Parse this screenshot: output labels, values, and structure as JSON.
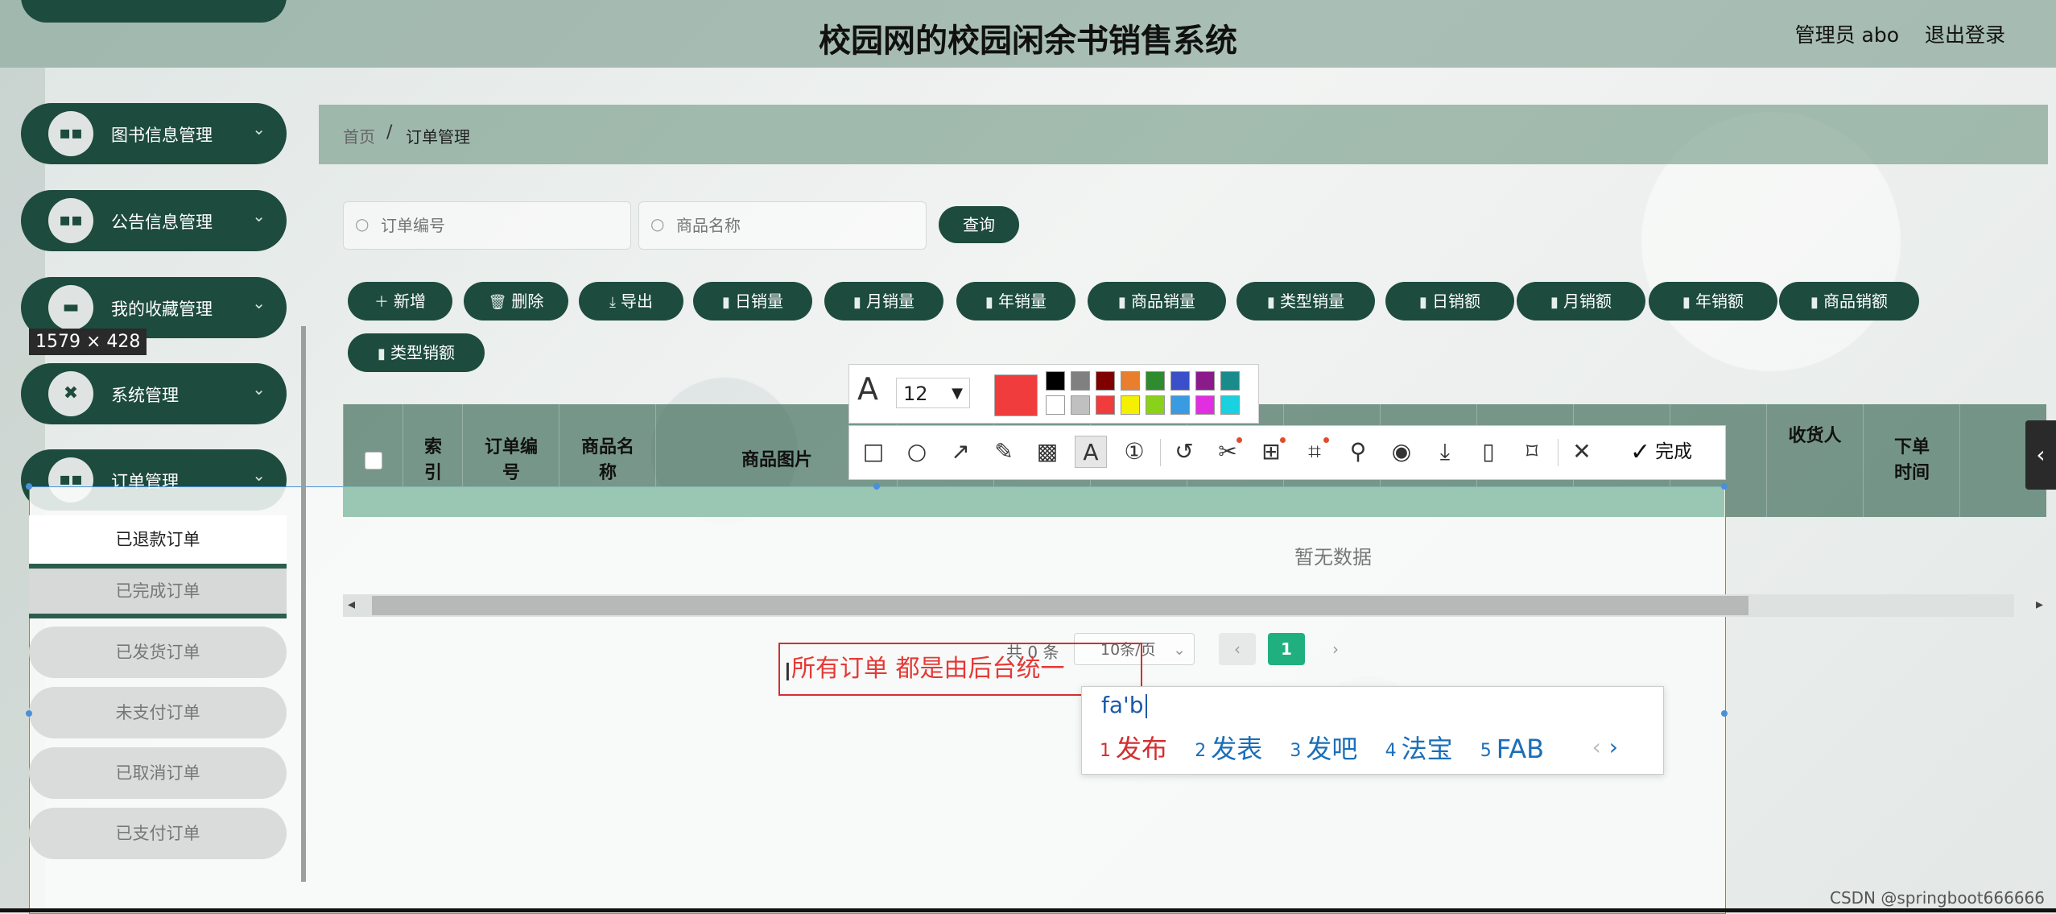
{
  "header": {
    "title": "校园网的校园闲余书销售系统",
    "admin": "管理员 abo",
    "logout": "退出登录"
  },
  "sidebar": {
    "menu": [
      {
        "label": "图书信息管理",
        "icon": "grid-icon"
      },
      {
        "label": "公告信息管理",
        "icon": "grid-icon"
      },
      {
        "label": "我的收藏管理",
        "icon": "monitor-icon"
      },
      {
        "label": "系统管理",
        "icon": "shuffle-icon"
      },
      {
        "label": "订单管理",
        "icon": "grid-icon"
      }
    ],
    "submenu": [
      "已退款订单",
      "已完成订单",
      "已发货订单",
      "未支付订单",
      "已取消订单",
      "已支付订单"
    ]
  },
  "dimension_label": "1579 × 428",
  "breadcrumb": {
    "home": "首页",
    "separator": "/",
    "current": "订单管理"
  },
  "search": {
    "order_no_placeholder": "订单编号",
    "product_name_placeholder": "商品名称",
    "query_label": "查询"
  },
  "toolbar_buttons": [
    {
      "label": "新增",
      "icon": "plus-icon"
    },
    {
      "label": "删除",
      "icon": "trash-icon"
    },
    {
      "label": "导出",
      "icon": "download-icon"
    },
    {
      "label": "日销量",
      "icon": "bar-chart-icon"
    },
    {
      "label": "月销量",
      "icon": "bar-chart-icon"
    },
    {
      "label": "年销量",
      "icon": "bar-chart-icon"
    },
    {
      "label": "商品销量",
      "icon": "bar-chart-icon"
    },
    {
      "label": "类型销量",
      "icon": "bar-chart-icon"
    },
    {
      "label": "日销额",
      "icon": "bar-chart-icon"
    },
    {
      "label": "月销额",
      "icon": "bar-chart-icon"
    },
    {
      "label": "年销额",
      "icon": "bar-chart-icon"
    },
    {
      "label": "商品销额",
      "icon": "bar-chart-icon"
    },
    {
      "label": "类型销额",
      "icon": "bar-chart-icon"
    }
  ],
  "table": {
    "columns": [
      "索引",
      "订单编号",
      "商品名称",
      "商品图片",
      "收货人",
      "下单时间"
    ],
    "empty_text": "暂无数据"
  },
  "pagination": {
    "total": "共 0 条",
    "page_size": "10条/页",
    "current_page": "1"
  },
  "annotation_text": "所有订单 都是由后台统一",
  "ime": {
    "composition": "fa'b",
    "candidates": [
      {
        "num": "1",
        "text": "发布"
      },
      {
        "num": "2",
        "text": "发表"
      },
      {
        "num": "3",
        "text": "发吧"
      },
      {
        "num": "4",
        "text": "法宝"
      },
      {
        "num": "5",
        "text": "FAB"
      }
    ]
  },
  "format_toolbar": {
    "font_size": "12",
    "current_color": "#f03c3c",
    "palette_row1": [
      "#000000",
      "#808080",
      "#800000",
      "#e87f2e",
      "#2e8b2e",
      "#3a4fc9",
      "#8b1a8b",
      "#1a8b8b"
    ],
    "palette_row2": [
      "#ffffff",
      "#c0c0c0",
      "#f03c3c",
      "#f5f000",
      "#8ad11a",
      "#3a9be0",
      "#e02ee0",
      "#1ad1e0"
    ]
  },
  "draw_toolbar": {
    "tools": [
      "rectangle-icon",
      "circle-icon",
      "arrow-icon",
      "pencil-icon",
      "mosaic-icon",
      "text-icon",
      "number-icon",
      "undo-icon",
      "scissors-icon",
      "translate-icon",
      "ocr-icon",
      "pin-icon",
      "record-icon",
      "download-icon",
      "long-screenshot-icon",
      "bookmark-icon",
      "close-icon"
    ],
    "done_label": "完成"
  },
  "watermark": "CSDN @springboot666666",
  "colors": {
    "primary": "#1d4b3d",
    "accent": "#20b080",
    "annotation": "#d32f2f"
  }
}
